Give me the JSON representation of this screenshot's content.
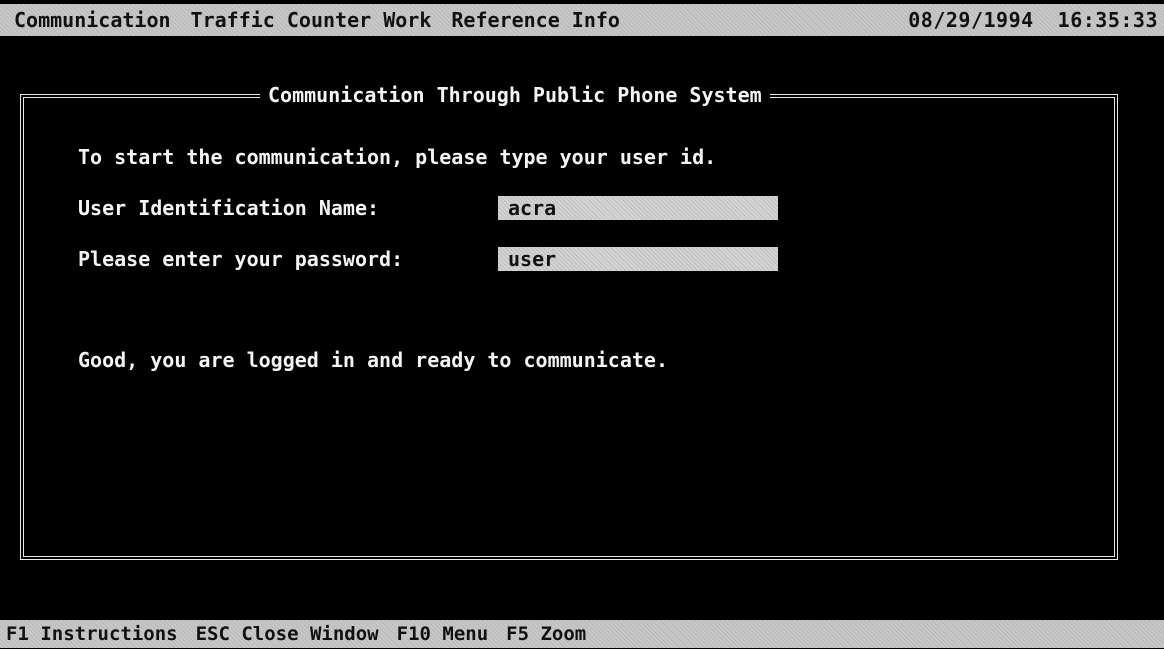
{
  "menu": {
    "items": [
      "Communication",
      "Traffic Counter Work",
      "Reference Info"
    ],
    "date": "08/29/1994",
    "time": "16:35:33"
  },
  "window": {
    "title": "Communication Through Public Phone System",
    "instruction": "To start the communication, please type your user id.",
    "user_label": "User Identification Name:",
    "user_value": "acra",
    "password_label": "Please enter your password:",
    "password_value": "user",
    "status_message": "Good, you are logged in and ready to communicate."
  },
  "statusbar": {
    "hints": [
      "F1 Instructions",
      "ESC Close Window",
      "F10 Menu",
      "F5 Zoom"
    ]
  }
}
